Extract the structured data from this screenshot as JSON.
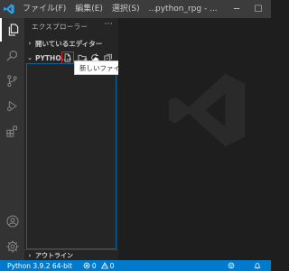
{
  "titlebar": {
    "logo_icon": "vscode-logo-icon",
    "menu": [
      {
        "label": "ファイル(F)"
      },
      {
        "label": "編集(E)"
      },
      {
        "label": "選択(S)"
      },
      {
        "label": "..."
      }
    ],
    "title": "python_rpg - ...",
    "controls": {
      "minimize": "─",
      "maximize": "☐"
    }
  },
  "activitybar": {
    "icons": [
      "explorer-icon",
      "search-icon",
      "source-control-icon",
      "run-debug-icon",
      "extensions-icon",
      "accounts-icon",
      "manage-gear-icon"
    ]
  },
  "sidebar": {
    "header": "エクスプローラー",
    "more": "···",
    "open_editors": {
      "label": "開いているエディター",
      "chevron": "›"
    },
    "folder": {
      "label": "PYTHO...",
      "chevron": "⌄"
    },
    "outline": {
      "label": "アウトライン",
      "chevron": "›"
    }
  },
  "tooltip": {
    "text": "新しいファイル"
  },
  "statusbar": {
    "python": "Python 3.9.2 64-bit",
    "errors": "0",
    "warnings": "0"
  },
  "colors": {
    "accent": "#007acc",
    "highlight_box": "#e0242c"
  }
}
